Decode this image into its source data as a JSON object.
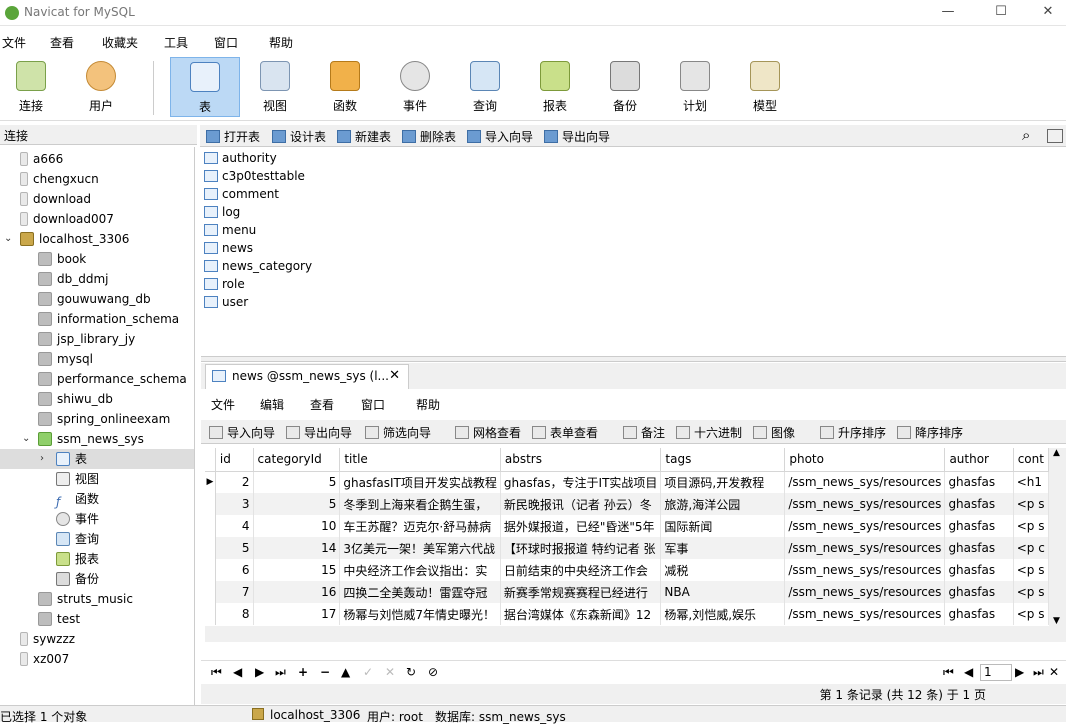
{
  "window": {
    "title": "Navicat for MySQL",
    "minimize": "—",
    "maximize": "☐",
    "close": "✕"
  },
  "menubar": [
    "文件",
    "查看",
    "收藏夹",
    "工具",
    "窗口",
    "帮助"
  ],
  "toolbar": [
    "连接",
    "用户",
    "表",
    "视图",
    "函数",
    "事件",
    "查询",
    "报表",
    "备份",
    "计划",
    "模型"
  ],
  "connections_header": "连接",
  "tree": {
    "top": [
      "a666",
      "chengxucn",
      "download",
      "download007"
    ],
    "server": "localhost_3306",
    "dbs": [
      "book",
      "db_ddmj",
      "gouwuwang_db",
      "information_schema",
      "jsp_library_jy",
      "mysql",
      "performance_schema",
      "shiwu_db",
      "spring_onlineexam"
    ],
    "active_db": "ssm_news_sys",
    "active_children": [
      "表",
      "视图",
      "函数",
      "事件",
      "查询",
      "报表",
      "备份"
    ],
    "dbs_after": [
      "struts_music",
      "test"
    ],
    "bottom": [
      "sywzzz",
      "xz007"
    ]
  },
  "object_toolbar": [
    "打开表",
    "设计表",
    "新建表",
    "删除表",
    "导入向导",
    "导出向导"
  ],
  "tables": [
    "authority",
    "c3p0testtable",
    "comment",
    "log",
    "menu",
    "news",
    "news_category",
    "role",
    "user"
  ],
  "tab": {
    "label": "news @ssm_news_sys (l...",
    "close": "✕"
  },
  "submenu": [
    "文件",
    "编辑",
    "查看",
    "窗口",
    "帮助"
  ],
  "grid_toolbar": [
    "导入向导",
    "导出向导",
    "筛选向导",
    "网格查看",
    "表单查看",
    "备注",
    "十六进制",
    "图像",
    "升序排序",
    "降序排序"
  ],
  "columns": [
    "id",
    "categoryId",
    "title",
    "abstrs",
    "tags",
    "photo",
    "author",
    "cont"
  ],
  "rows": [
    [
      "2",
      "5",
      "ghasfasIT项目开发实战教程",
      "ghasfas，专注于IT实战项目",
      "项目源码,开发教程",
      "/ssm_news_sys/resources",
      "ghasfas",
      "<h1"
    ],
    [
      "3",
      "5",
      "冬季到上海来看企鹅生蛋，",
      "新民晚报讯（记者 孙云）冬",
      "旅游,海洋公园",
      "/ssm_news_sys/resources",
      "ghasfas",
      "<p s"
    ],
    [
      "4",
      "10",
      "车王苏醒？迈克尔·舒马赫病",
      "据外媒报道，已经\"昏迷\"5年",
      "国际新闻",
      "/ssm_news_sys/resources",
      "ghasfas",
      "<p s"
    ],
    [
      "5",
      "14",
      "3亿美元一架！美军第六代战",
      "【环球时报报道 特约记者 张",
      "军事",
      "/ssm_news_sys/resources",
      "ghasfas",
      "<p c"
    ],
    [
      "6",
      "15",
      "中央经济工作会议指出：实",
      "日前结束的中央经济工作会",
      "减税",
      "/ssm_news_sys/resources",
      "ghasfas",
      "<p s"
    ],
    [
      "7",
      "16",
      "四换二全美轰动！雷霆夺冠",
      "新赛季常规赛赛程已经进行",
      "NBA",
      "/ssm_news_sys/resources",
      "ghasfas",
      "<p s"
    ],
    [
      "8",
      "17",
      "杨幂与刘恺威7年情史曝光！",
      "据台湾媒体《东森新闻》12",
      "杨幂,刘恺威,娱乐",
      "/ssm_news_sys/resources",
      "ghasfas",
      "<p s"
    ]
  ],
  "nav": {
    "page": "1"
  },
  "record_info": "第 1 条记录 (共 12 条) 于 1 页",
  "status": {
    "left": "已选择 1 个对象",
    "server": "localhost_3306",
    "user": "用户: root",
    "db": "数据库: ssm_news_sys"
  },
  "colors": {
    "active_tool": "#bcd9f5",
    "selection": "#dddddd"
  }
}
